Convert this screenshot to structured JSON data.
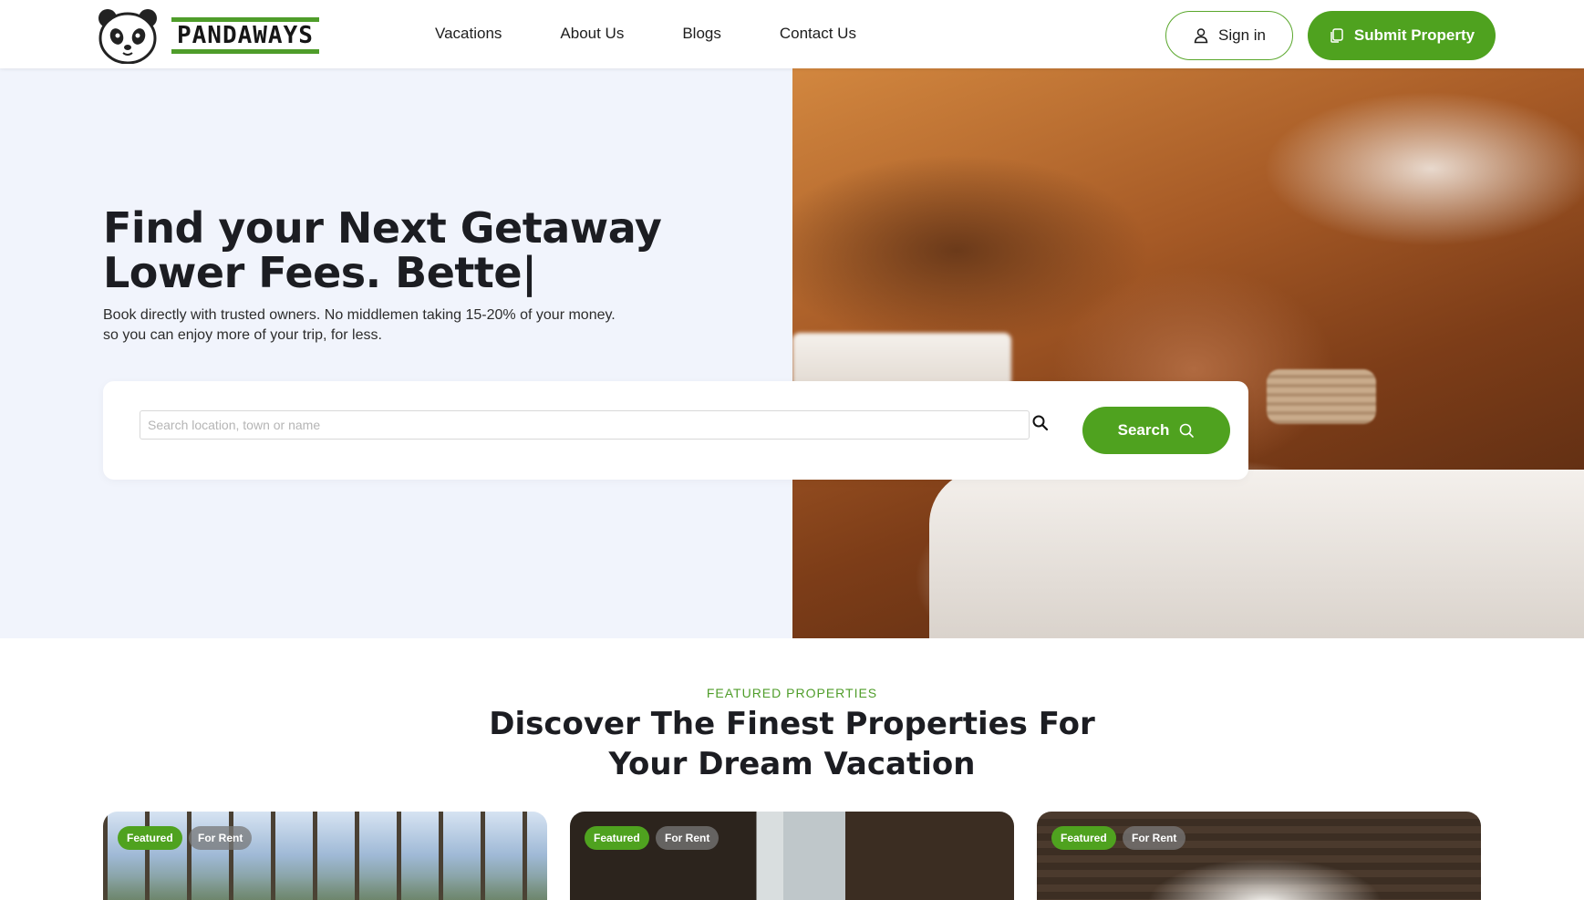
{
  "header": {
    "brand": "PANDAWAYS",
    "nav": [
      "Vacations",
      "About Us",
      "Blogs",
      "Contact Us"
    ],
    "signin_label": "Sign in",
    "submit_label": "Submit Property"
  },
  "hero": {
    "title_line1": "Find your Next Getaway",
    "title_line2": "Lower Fees. Bette|",
    "subtitle_line1": "Book directly with trusted owners. No middlemen taking 15-20% of your money.",
    "subtitle_line2": "so you can enjoy more of your trip, for less."
  },
  "search": {
    "placeholder": "Search location, town or name",
    "value": "",
    "button_label": "Search"
  },
  "featured": {
    "eyebrow": "FEATURED PROPERTIES",
    "title_line1": "Discover The Finest Properties For",
    "title_line2": "Your Dream Vacation",
    "cards": [
      {
        "badge_featured": "Featured",
        "badge_status": "For Rent"
      },
      {
        "badge_featured": "Featured",
        "badge_status": "For Rent"
      },
      {
        "badge_featured": "Featured",
        "badge_status": "For Rent"
      }
    ]
  },
  "colors": {
    "accent": "#4fa21f",
    "hero_bg": "#f1f4fc",
    "text": "#1c1d22"
  }
}
